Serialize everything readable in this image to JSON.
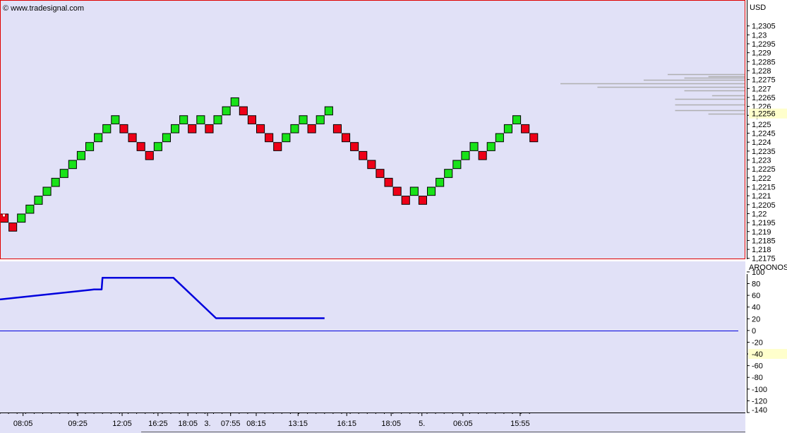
{
  "watermark": "© www.tradesignal.com",
  "colors": {
    "plot_bg": "#e1e1f7",
    "axis_bg": "#ffffff",
    "frame_red": "#e00000",
    "up_brick": "#19e219",
    "down_brick": "#ee0018",
    "brick_edge": "#000000",
    "oscillator_line": "#0000dd",
    "profile_line": "#b0b0b0",
    "marker_bg": "#ffffcc"
  },
  "chart_data": [
    {
      "type": "renko",
      "currency_label": "USD",
      "brick_size": 0.0005,
      "y_ticks": [
        "1,2305",
        "1,23",
        "1,2295",
        "1,229",
        "1,2285",
        "1,228",
        "1,2275",
        "1,227",
        "1,2265",
        "1,226",
        "1,2255",
        "1,225",
        "1,2245",
        "1,224",
        "1,2235",
        "1,223",
        "1,2225",
        "1,222",
        "1,2215",
        "1,221",
        "1,2205",
        "1,22",
        "1,2195",
        "1,219",
        "1,2185",
        "1,218",
        "1,2175"
      ],
      "y_tick_values": [
        1.2305,
        1.23,
        1.2295,
        1.229,
        1.2285,
        1.228,
        1.2275,
        1.227,
        1.2265,
        1.226,
        1.2255,
        1.225,
        1.2245,
        1.224,
        1.2235,
        1.223,
        1.2225,
        1.222,
        1.2215,
        1.221,
        1.2205,
        1.22,
        1.2195,
        1.219,
        1.2185,
        1.218,
        1.2175
      ],
      "ylim": [
        1.21745,
        1.23195
      ],
      "last_price_label": "1,2256",
      "last_price": 1.2256,
      "bricks": [
        {
          "dir": "down",
          "low": 1.2195,
          "high": 1.22
        },
        {
          "dir": "down",
          "low": 1.219,
          "high": 1.2195
        },
        {
          "dir": "up",
          "low": 1.2195,
          "high": 1.22
        },
        {
          "dir": "up",
          "low": 1.22,
          "high": 1.2205
        },
        {
          "dir": "up",
          "low": 1.2205,
          "high": 1.221
        },
        {
          "dir": "up",
          "low": 1.221,
          "high": 1.2215
        },
        {
          "dir": "up",
          "low": 1.2215,
          "high": 1.222
        },
        {
          "dir": "up",
          "low": 1.222,
          "high": 1.2225
        },
        {
          "dir": "up",
          "low": 1.2225,
          "high": 1.223
        },
        {
          "dir": "up",
          "low": 1.223,
          "high": 1.2235
        },
        {
          "dir": "up",
          "low": 1.2235,
          "high": 1.224
        },
        {
          "dir": "up",
          "low": 1.224,
          "high": 1.2245
        },
        {
          "dir": "up",
          "low": 1.2245,
          "high": 1.225
        },
        {
          "dir": "up",
          "low": 1.225,
          "high": 1.2255
        },
        {
          "dir": "down",
          "low": 1.2245,
          "high": 1.225
        },
        {
          "dir": "down",
          "low": 1.224,
          "high": 1.2245
        },
        {
          "dir": "down",
          "low": 1.2235,
          "high": 1.224
        },
        {
          "dir": "down",
          "low": 1.223,
          "high": 1.2235
        },
        {
          "dir": "up",
          "low": 1.2235,
          "high": 1.224
        },
        {
          "dir": "up",
          "low": 1.224,
          "high": 1.2245
        },
        {
          "dir": "up",
          "low": 1.2245,
          "high": 1.225
        },
        {
          "dir": "up",
          "low": 1.225,
          "high": 1.2255
        },
        {
          "dir": "down",
          "low": 1.2245,
          "high": 1.225
        },
        {
          "dir": "up",
          "low": 1.225,
          "high": 1.2255
        },
        {
          "dir": "down",
          "low": 1.2245,
          "high": 1.225
        },
        {
          "dir": "up",
          "low": 1.225,
          "high": 1.2255
        },
        {
          "dir": "up",
          "low": 1.2255,
          "high": 1.226
        },
        {
          "dir": "up",
          "low": 1.226,
          "high": 1.2265
        },
        {
          "dir": "down",
          "low": 1.2255,
          "high": 1.226
        },
        {
          "dir": "down",
          "low": 1.225,
          "high": 1.2255
        },
        {
          "dir": "down",
          "low": 1.2245,
          "high": 1.225
        },
        {
          "dir": "down",
          "low": 1.224,
          "high": 1.2245
        },
        {
          "dir": "down",
          "low": 1.2235,
          "high": 1.224
        },
        {
          "dir": "up",
          "low": 1.224,
          "high": 1.2245
        },
        {
          "dir": "up",
          "low": 1.2245,
          "high": 1.225
        },
        {
          "dir": "up",
          "low": 1.225,
          "high": 1.2255
        },
        {
          "dir": "down",
          "low": 1.2245,
          "high": 1.225
        },
        {
          "dir": "up",
          "low": 1.225,
          "high": 1.2255
        },
        {
          "dir": "up",
          "low": 1.2255,
          "high": 1.226
        },
        {
          "dir": "down",
          "low": 1.2245,
          "high": 1.225
        },
        {
          "dir": "down",
          "low": 1.224,
          "high": 1.2245
        },
        {
          "dir": "down",
          "low": 1.2235,
          "high": 1.224
        },
        {
          "dir": "down",
          "low": 1.223,
          "high": 1.2235
        },
        {
          "dir": "down",
          "low": 1.2225,
          "high": 1.223
        },
        {
          "dir": "down",
          "low": 1.222,
          "high": 1.2225
        },
        {
          "dir": "down",
          "low": 1.2215,
          "high": 1.222
        },
        {
          "dir": "down",
          "low": 1.221,
          "high": 1.2215
        },
        {
          "dir": "down",
          "low": 1.2205,
          "high": 1.221
        },
        {
          "dir": "up",
          "low": 1.221,
          "high": 1.2215
        },
        {
          "dir": "down",
          "low": 1.2205,
          "high": 1.221
        },
        {
          "dir": "up",
          "low": 1.221,
          "high": 1.2215
        },
        {
          "dir": "up",
          "low": 1.2215,
          "high": 1.222
        },
        {
          "dir": "up",
          "low": 1.222,
          "high": 1.2225
        },
        {
          "dir": "up",
          "low": 1.2225,
          "high": 1.223
        },
        {
          "dir": "up",
          "low": 1.223,
          "high": 1.2235
        },
        {
          "dir": "up",
          "low": 1.2235,
          "high": 1.224
        },
        {
          "dir": "down",
          "low": 1.223,
          "high": 1.2235
        },
        {
          "dir": "up",
          "low": 1.2235,
          "high": 1.224
        },
        {
          "dir": "up",
          "low": 1.224,
          "high": 1.2245
        },
        {
          "dir": "up",
          "low": 1.2245,
          "high": 1.225
        },
        {
          "dir": "up",
          "low": 1.225,
          "high": 1.2255
        },
        {
          "dir": "down",
          "low": 1.2245,
          "high": 1.225
        },
        {
          "dir": "down",
          "low": 1.224,
          "high": 1.2245
        }
      ],
      "volume_profile": [
        {
          "price": 1.2278,
          "width": 0.42
        },
        {
          "price": 1.2277,
          "width": 0.2
        },
        {
          "price": 1.2276,
          "width": 0.33
        },
        {
          "price": 1.2275,
          "width": 0.55
        },
        {
          "price": 1.2273,
          "width": 1.0
        },
        {
          "price": 1.2271,
          "width": 0.8
        },
        {
          "price": 1.2269,
          "width": 0.33
        },
        {
          "price": 1.2266,
          "width": 0.18
        },
        {
          "price": 1.2264,
          "width": 0.38
        },
        {
          "price": 1.2261,
          "width": 0.38
        },
        {
          "price": 1.2258,
          "width": 0.38
        },
        {
          "price": 1.2256,
          "width": 0.2
        }
      ]
    },
    {
      "type": "line",
      "title": "AROONOS",
      "y_ticks": [
        "100",
        "80",
        "60",
        "40",
        "20",
        "0",
        "-20",
        "-40",
        "-60",
        "-80",
        "-100",
        "-120",
        "-140"
      ],
      "y_tick_values": [
        100,
        80,
        60,
        40,
        20,
        0,
        -20,
        -40,
        -60,
        -80,
        -100,
        -120,
        -140
      ],
      "ylim": [
        -140,
        118
      ],
      "marker_label": "-40",
      "marker_value": -40,
      "zero_line": 0,
      "series": [
        {
          "x": [
            0,
            11,
            11.9,
            12,
            20.3,
            25.3,
            38
          ],
          "y": [
            53,
            70,
            70,
            90,
            90,
            21,
            21
          ]
        }
      ]
    }
  ],
  "x_axis": {
    "labels": [
      {
        "text": "08:05",
        "pos": 2.7
      },
      {
        "text": "09:25",
        "pos": 9.1
      },
      {
        "text": "12:05",
        "pos": 14.3
      },
      {
        "text": "16:25",
        "pos": 18.5
      },
      {
        "text": "18:05",
        "pos": 22.0
      },
      {
        "text": "3.",
        "pos": 24.3
      },
      {
        "text": "07:55",
        "pos": 27.0
      },
      {
        "text": "08:15",
        "pos": 30.0
      },
      {
        "text": "13:15",
        "pos": 34.9
      },
      {
        "text": "16:15",
        "pos": 40.6
      },
      {
        "text": "18:05",
        "pos": 45.8
      },
      {
        "text": "5.",
        "pos": 49.4
      },
      {
        "text": "06:05",
        "pos": 54.2
      },
      {
        "text": "15:55",
        "pos": 60.9
      }
    ]
  }
}
